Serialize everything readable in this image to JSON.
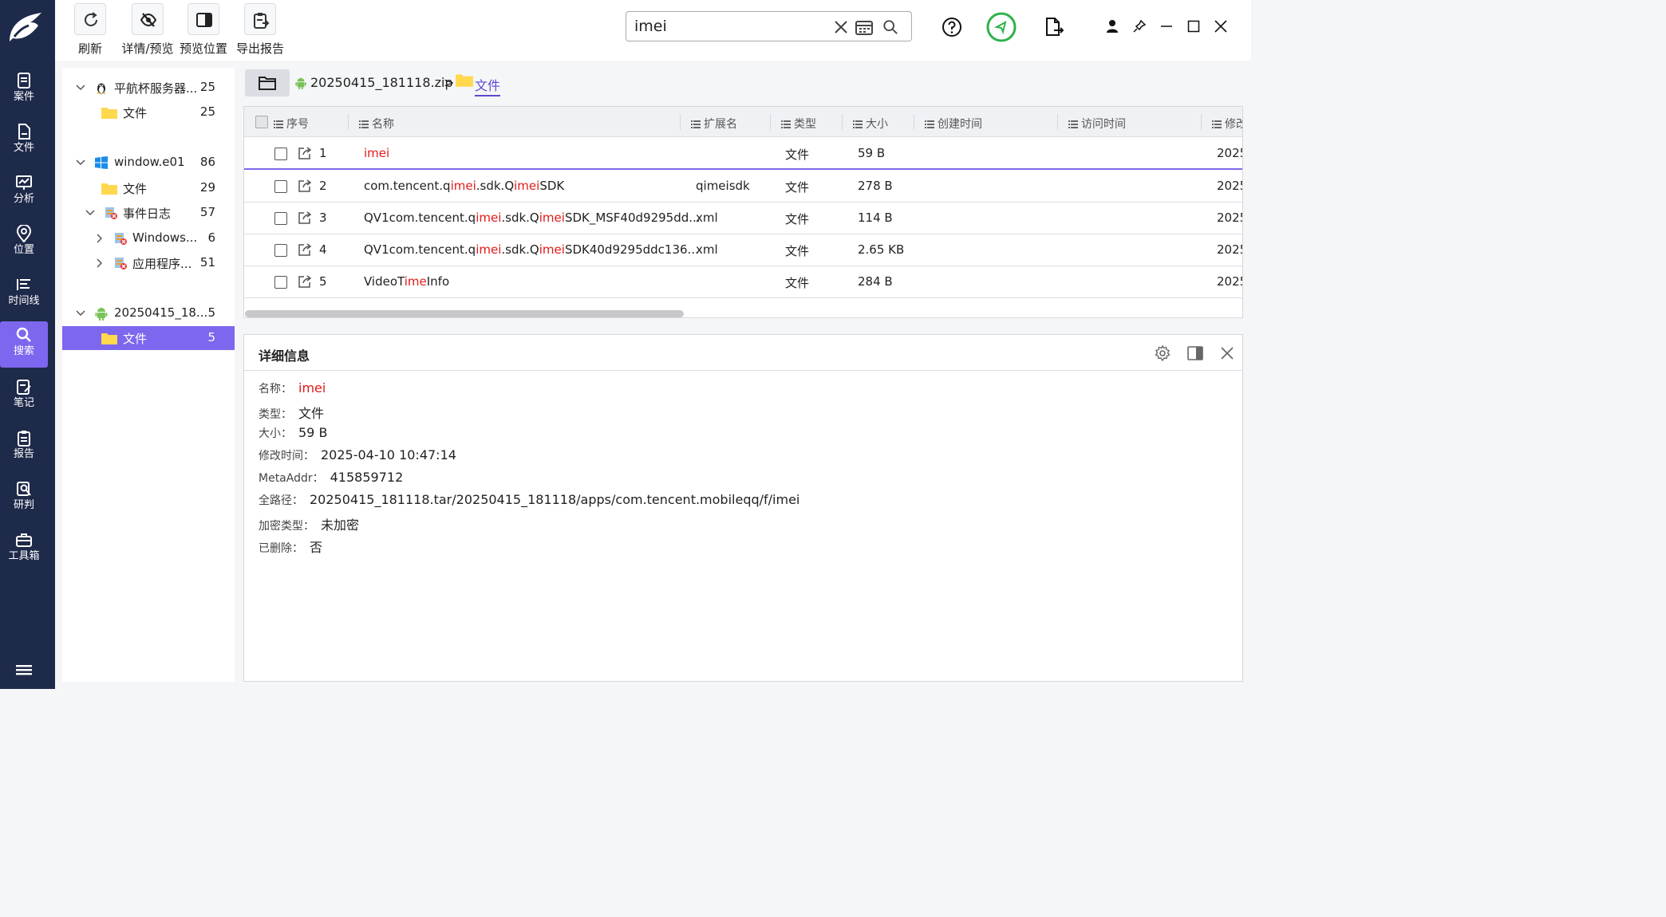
{
  "nav": {
    "items": [
      {
        "label": "案件",
        "icon": "case-icon"
      },
      {
        "label": "文件",
        "icon": "file-icon"
      },
      {
        "label": "分析",
        "icon": "analysis-icon"
      },
      {
        "label": "位置",
        "icon": "location-icon"
      },
      {
        "label": "时间线",
        "icon": "timeline-icon"
      },
      {
        "label": "搜索",
        "icon": "search-icon",
        "active": true
      },
      {
        "label": "笔记",
        "icon": "notes-icon"
      },
      {
        "label": "报告",
        "icon": "report-icon"
      },
      {
        "label": "研判",
        "icon": "judgment-icon"
      },
      {
        "label": "工具箱",
        "icon": "toolbox-icon"
      }
    ]
  },
  "toolbar": {
    "refresh": "刷新",
    "detail_preview": "详情/预览",
    "preview_position": "预览位置",
    "export_report": "导出报告"
  },
  "search": {
    "value": "imei"
  },
  "tree": {
    "n1": {
      "label": "平航杯服务器...",
      "count": "25"
    },
    "n1_files": {
      "label": "文件",
      "count": "25"
    },
    "n2": {
      "label": "window.e01",
      "count": "86"
    },
    "n2_files": {
      "label": "文件",
      "count": "29"
    },
    "n2_events": {
      "label": "事件日志",
      "count": "57"
    },
    "n2_windows": {
      "label": "Windows...",
      "count": "6"
    },
    "n2_apps": {
      "label": "应用程序...",
      "count": "51"
    },
    "n3": {
      "label": "20250415_18...",
      "count": "5"
    },
    "n3_files": {
      "label": "文件",
      "count": "5"
    }
  },
  "breadcrumb": {
    "zip": "20250415_181118.zip",
    "sep": ">",
    "folder": "文件"
  },
  "table": {
    "headers": {
      "index": "序号",
      "name": "名称",
      "ext": "扩展名",
      "type": "类型",
      "size": "大小",
      "created": "创建时间",
      "accessed": "访问时间",
      "modified": "修改"
    },
    "rows": [
      {
        "index": "1",
        "name_pre": "",
        "name_hl1": "imei",
        "name_mid": "",
        "name_hl2": "",
        "name_post": "",
        "ext": "",
        "type": "文件",
        "size": "59 B",
        "modified": "2025"
      },
      {
        "index": "2",
        "name_pre": "com.tencent.q",
        "name_hl1": "imei",
        "name_mid": ".sdk.Q",
        "name_hl2": "imei",
        "name_post": "SDK",
        "ext": "qimeisdk",
        "type": "文件",
        "size": "278 B",
        "modified": "2025"
      },
      {
        "index": "3",
        "name_pre": "QV1com.tencent.q",
        "name_hl1": "imei",
        "name_mid": ".sdk.Q",
        "name_hl2": "imei",
        "name_post": "SDK_MSF40d9295dd...",
        "ext": "xml",
        "type": "文件",
        "size": "114 B",
        "modified": "2025"
      },
      {
        "index": "4",
        "name_pre": "QV1com.tencent.q",
        "name_hl1": "imei",
        "name_mid": ".sdk.Q",
        "name_hl2": "imei",
        "name_post": "SDK40d9295ddc136...",
        "ext": "xml",
        "type": "文件",
        "size": "2.65 KB",
        "modified": "2025"
      },
      {
        "index": "5",
        "name_pre": "VideoT",
        "name_hl1": "ime",
        "name_mid": "Info",
        "name_hl2": "",
        "name_post": "",
        "ext": "",
        "type": "文件",
        "size": "284 B",
        "modified": "2025"
      }
    ]
  },
  "detail": {
    "title": "详细信息",
    "name_k": "名称：",
    "name_v": "imei",
    "type_k": "类型：",
    "type_v": "文件",
    "size_k": "大小：",
    "size_v": "59 B",
    "mtime_k": "修改时间：",
    "mtime_v": "2025-04-10 10:47:14",
    "meta_k": "MetaAddr：",
    "meta_v": "415859712",
    "path_k": "全路径：",
    "path_v": "20250415_181118.tar/20250415_181118/apps/com.tencent.mobileqq/f/imei",
    "enc_k": "加密类型：",
    "enc_v": "未加密",
    "del_k": "已删除：",
    "del_v": "否"
  },
  "colors": {
    "accent": "#7d67ee",
    "sidebar": "#1e2a4a",
    "highlight": "#e21919",
    "status_green": "#2fb24a"
  }
}
